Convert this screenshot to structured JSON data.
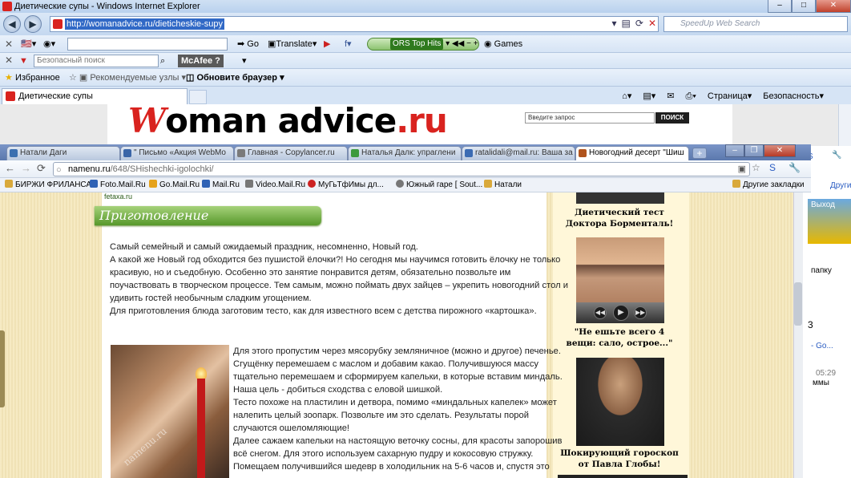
{
  "ie": {
    "title": "Диетические супы - Windows Internet Explorer",
    "url": "http://womanadvice.ru/dieticheskie-supy",
    "search_placeholder": "SpeedUp Web Search",
    "toolbar1": {
      "go": "Go",
      "translate": "Translate",
      "radio": "ORS Top Hits",
      "games": "Games"
    },
    "toolbar2": {
      "search_placeholder": "Безопасный поиск",
      "mcafee": "McAfee"
    },
    "favorites": {
      "label": "Избранное",
      "recommended": "Рекомендуемые узлы",
      "update": "Обновите браузер"
    },
    "tab_title": "Диетические супы",
    "commands": {
      "page": "Страница",
      "security": "Безопасность"
    }
  },
  "womanadvice": {
    "logo_w": "W",
    "logo_mid": "oman advice",
    "logo_ru": ".ru",
    "search_placeholder": "Введите запрос",
    "search_button": "ПОИСК"
  },
  "chrome": {
    "tabs": [
      {
        "label": "Натали Даги",
        "color": "#3a6fb0"
      },
      {
        "label": "\" Письмо «Акция WebMo",
        "color": "#3b66a8"
      },
      {
        "label": "Главная - Copylancer.ru",
        "color": "#7a7a7a"
      },
      {
        "label": "Наталья Далк: упраглени",
        "color": "#3d9a3d"
      },
      {
        "label": "ratalidali@mail.ru: Ваша за",
        "color": "#3b6bb3"
      },
      {
        "label": "Новогодний десерт \"Шиш",
        "color": "#b0531c"
      }
    ],
    "url_domain": "namenu.ru",
    "url_path": "/648/SHishechki-igolochki/",
    "bookmarks": [
      {
        "label": "БИРЖИ ФРИЛАНСА",
        "color": "#d9a93b"
      },
      {
        "label": "Foto.Mail.Ru",
        "color": "#2f62b5"
      },
      {
        "label": "Go.Mail.Ru",
        "color": "#e5a21b"
      },
      {
        "label": "Mail.Ru",
        "color": "#2f62b5"
      },
      {
        "label": "Video.Mail.Ru",
        "color": "#777777"
      },
      {
        "label": "МуГьТфИмы дл...",
        "color": "#cc2222"
      },
      {
        "label": "Южный гаре [ Sout...",
        "color": "#777777"
      },
      {
        "label": "Натали",
        "color": "#d9a93b"
      }
    ],
    "other_bookmarks": "Другие закладки"
  },
  "article": {
    "source": "fetaxa.ru",
    "section_title": "Приготовление",
    "intro_lines": [
      "Самый семейный и самый ожидаемый праздник, несомненно, Новый год.",
      "А какой же Новый год обходится без пушистой ёлочки?! Но сегодня мы научимся готовить ёлочку не только",
      "красивую, но и съедобную. Особенно это занятие понравится детям, обязательно позвольте им",
      "поучаствовать в творческом процессе. Тем самым, можно поймать двух зайцев – укрепить новогодний стол и",
      "удивить гостей необычным сладким угощением.",
      "Для приготовления блюда заготовим тесто, как для известного всем с детства пирожного «картошка»."
    ],
    "body_lines": [
      "Для этого пропустим через мясорубку земляничное (можно и другое) печенье.",
      "Сгущёнку перемешаем с маслом и добавим какао. Получившуюся массу",
      "тщательно перемешаем и сформируем капельки, в которые вставим миндаль.",
      "Наша цель - добиться сходства с еловой шишкой.",
      "Тесто похоже на пластилин и детвора, помимо «миндальных капелек» может",
      "налепить целый зоопарк. Позвольте им это сделать. Результаты порой",
      "случаются ошеломляющие!",
      "Далее сажаем капельки на настоящую веточку сосны, для красоты запорошив",
      "всё снегом. Для этого используем сахарную пудру и кокосовую стружку.",
      "Помещаем получившийся шедевр в холодильник на 5-6 часов и, спустя это"
    ],
    "photo_watermark": "namenu.ru"
  },
  "sidebar": {
    "card1": "Диетический тест Доктора Борменталь!",
    "card2": "\"Не ешьте всего 4 вещи: сало, острое...\"",
    "card3": "Шокирующий гороскоп от Павла Глобы!"
  },
  "right_strip": {
    "exit": "Выход",
    "folder": "папку",
    "num": "3",
    "link": "- Go...",
    "time": "05:29",
    "tail": "ммы"
  }
}
